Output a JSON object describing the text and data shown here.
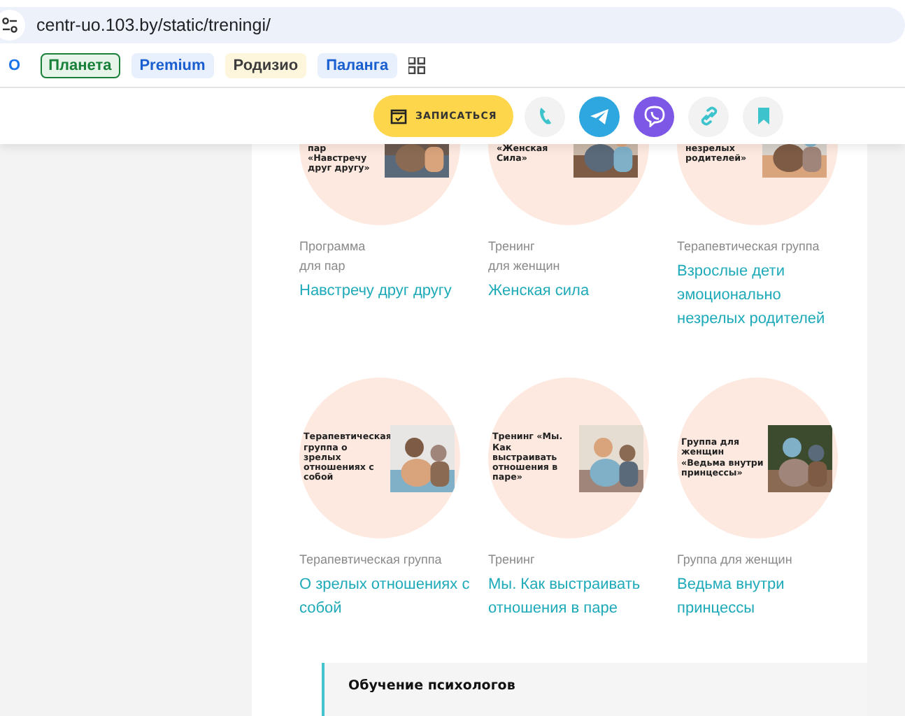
{
  "address_bar": {
    "url": "centr-uo.103.by/static/treningi/"
  },
  "bookmarks": [
    {
      "label": "О",
      "kind": "plain"
    },
    {
      "label": "Планета",
      "kind": "outlined"
    },
    {
      "label": "Premium",
      "kind": "blue"
    },
    {
      "label": "Родизио",
      "kind": "cream"
    },
    {
      "label": "Паланга",
      "kind": "blue"
    }
  ],
  "action_bar": [
    {
      "kind": "book",
      "label": "ЗАПИСАТЬСЯ"
    },
    {
      "kind": "phone"
    },
    {
      "kind": "telegram"
    },
    {
      "kind": "viber"
    },
    {
      "kind": "link"
    },
    {
      "kind": "bookmark"
    }
  ],
  "card_rows": [
    {
      "cut": true,
      "cards": [
        {
          "circle_text": "пар «Навстречу друг другу»",
          "category_lines": [
            "Программа",
            "для пар"
          ],
          "title_lines": [
            "Навстречу друг другу"
          ]
        },
        {
          "circle_text": "«Женская Сила»",
          "category_lines": [
            "Тренинг",
            "для женщин"
          ],
          "title_lines": [
            "Женская сила"
          ]
        },
        {
          "circle_text": "незрелых родителей»",
          "category_lines": [
            "Терапевтическая группа"
          ],
          "title_lines": [
            "Взрослые дети",
            "эмоционально",
            "незрелых родителей"
          ]
        }
      ]
    },
    {
      "cut": false,
      "cards": [
        {
          "circle_text": "Терапевтическая группа о зрелых отношениях с собой",
          "category_lines": [
            "Терапевтическая группа"
          ],
          "title_lines": [
            "О зрелых отношениях с",
            "собой"
          ]
        },
        {
          "circle_text": "Тренинг «Мы. Как выстраивать отношения в паре»",
          "category_lines": [
            "Тренинг"
          ],
          "title_lines": [
            "Мы. Как выстраивать",
            "отношения в паре"
          ]
        },
        {
          "circle_text": "Группа для женщин «Ведьма внутри принцессы»",
          "category_lines": [
            "Группа для женщин"
          ],
          "title_lines": [
            "Ведьма внутри",
            "принцессы"
          ]
        }
      ]
    }
  ],
  "section": {
    "title": "Обучение психологов"
  }
}
